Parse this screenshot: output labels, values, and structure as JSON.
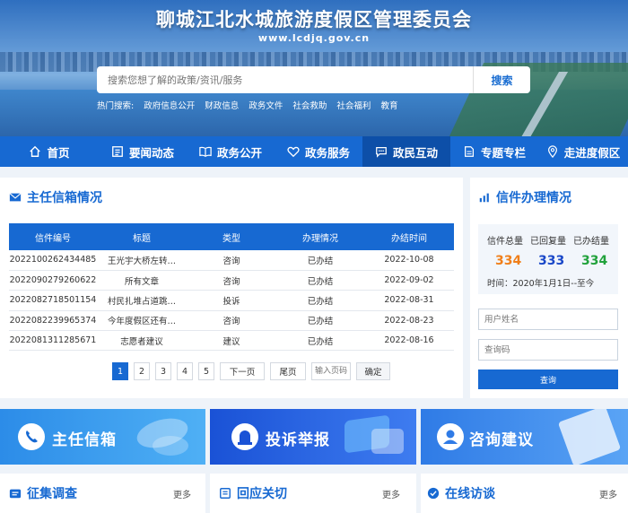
{
  "header": {
    "title": "聊城江北水城旅游度假区管理委员会",
    "url": "www.lcdjq.gov.cn",
    "search_placeholder": "搜索您想了解的政策/资讯/服务",
    "search_button": "搜索",
    "hot_label": "热门搜索:",
    "hot_terms": [
      "政府信息公开",
      "财政信息",
      "政务文件",
      "社会救助",
      "社会福利",
      "教育"
    ]
  },
  "nav": {
    "items": [
      {
        "label": "首页",
        "icon": "home-icon"
      },
      {
        "label": "要闻动态",
        "icon": "news-icon"
      },
      {
        "label": "政务公开",
        "icon": "book-icon"
      },
      {
        "label": "政务服务",
        "icon": "heart-icon"
      },
      {
        "label": "政民互动",
        "icon": "chat-icon",
        "active": true
      },
      {
        "label": "专题专栏",
        "icon": "file-icon"
      },
      {
        "label": "走进度假区",
        "icon": "location-icon"
      }
    ]
  },
  "mailbox": {
    "title": "主任信箱情况",
    "columns": [
      "信件编号",
      "标题",
      "类型",
      "办理情况",
      "办结时间"
    ],
    "rows": [
      [
        "2022100262434485",
        "王光宇大桥左转…",
        "咨询",
        "已办结",
        "2022-10-08"
      ],
      [
        "2022090279260622",
        "所有文章",
        "咨询",
        "已办结",
        "2022-09-02"
      ],
      [
        "2022082718501154",
        "村民扎堆占道跳…",
        "投诉",
        "已办结",
        "2022-08-31"
      ],
      [
        "2022082239965374",
        "今年度假区还有…",
        "咨询",
        "已办结",
        "2022-08-23"
      ],
      [
        "2022081311285671",
        "志愿者建议",
        "建议",
        "已办结",
        "2022-08-16"
      ]
    ],
    "pager": {
      "pages": [
        "1",
        "2",
        "3",
        "4",
        "5"
      ],
      "current": "1",
      "next": "下一页",
      "last": "尾页",
      "input_placeholder": "输入页码",
      "go": "确定"
    }
  },
  "letters": {
    "title": "信件办理情况",
    "stats": [
      {
        "label": "信件总量",
        "value": "334",
        "color": "#f07f1a"
      },
      {
        "label": "已回复量",
        "value": "333",
        "color": "#1a48c8"
      },
      {
        "label": "已办结量",
        "value": "334",
        "color": "#22a23c"
      }
    ],
    "time": "时间：2020年1月1日--至今",
    "username_placeholder": "用户姓名",
    "code_placeholder": "查询码",
    "query_button": "查询"
  },
  "cards": [
    {
      "label": "主任信箱",
      "icon": "phone-icon"
    },
    {
      "label": "投诉举报",
      "icon": "alarm-icon"
    },
    {
      "label": "咨询建议",
      "icon": "user-icon"
    }
  ],
  "sections": [
    {
      "title": "征集调查",
      "more": "更多"
    },
    {
      "title": "回应关切",
      "more": "更多"
    },
    {
      "title": "在线访谈",
      "more": "更多"
    }
  ],
  "colors": {
    "primary": "#1769d2",
    "nav_active": "#0d4fa8"
  }
}
